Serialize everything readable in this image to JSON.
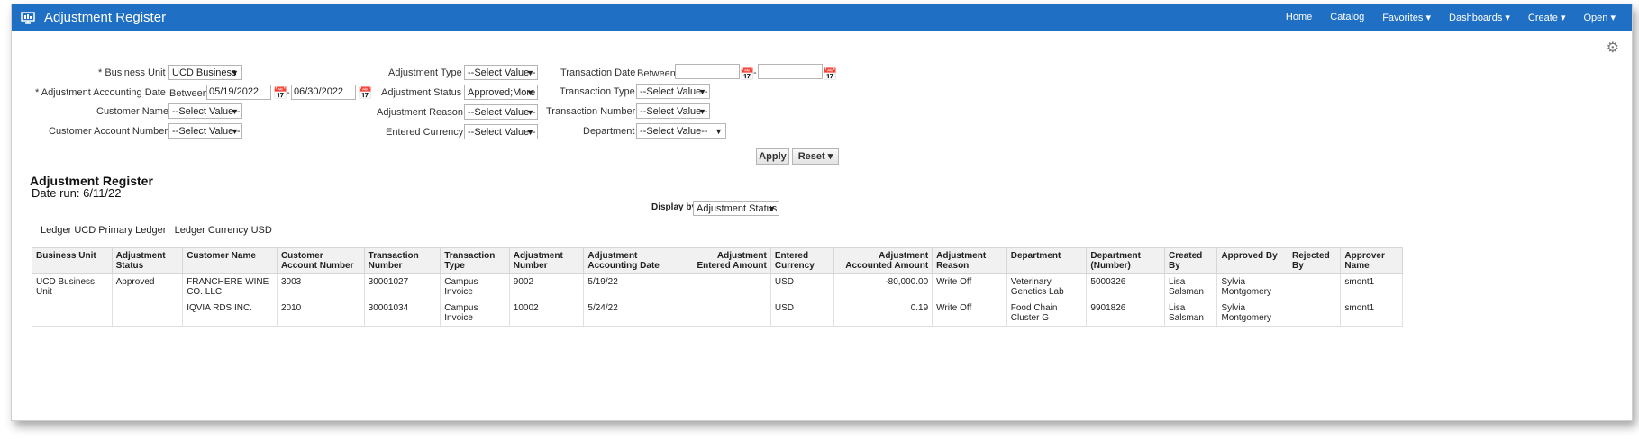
{
  "app": {
    "title": "Adjustment Register"
  },
  "nav": {
    "home": "Home",
    "catalog": "Catalog",
    "favorites": "Favorites ▾",
    "dashboards": "Dashboards ▾",
    "create": "Create ▾",
    "open": "Open ▾"
  },
  "prompts": {
    "business_unit": {
      "label": "* Business Unit",
      "value": "UCD Business"
    },
    "acct_date": {
      "label": "* Adjustment Accounting Date",
      "between": "Between",
      "from": "05/19/2022",
      "dash": "-",
      "to": "06/30/2022"
    },
    "customer_name": {
      "label": "Customer Name",
      "value": "--Select Value--"
    },
    "customer_account": {
      "label": "Customer Account Number",
      "value": "--Select Value--"
    },
    "adj_type": {
      "label": "Adjustment Type",
      "value": "--Select Value--"
    },
    "adj_status": {
      "label": "Adjustment Status",
      "value": "Approved;More"
    },
    "adj_reason": {
      "label": "Adjustment Reason",
      "value": "--Select Value--"
    },
    "entered_currency": {
      "label": "Entered Currency",
      "value": "--Select Value--"
    },
    "trx_date": {
      "label": "Transaction Date",
      "between": "Between",
      "from": "",
      "dash": "-",
      "to": ""
    },
    "trx_type": {
      "label": "Transaction Type",
      "value": "--Select Value--"
    },
    "trx_number": {
      "label": "Transaction Number",
      "value": "--Select Value--"
    },
    "department": {
      "label": "Department",
      "value": "--Select Value--"
    },
    "apply": "Apply",
    "reset": "Reset ▾"
  },
  "report": {
    "title": "Adjustment Register",
    "date_run": "Date run: 6/11/22",
    "display_by_label": "Display by",
    "display_by_value": "Adjustment Status",
    "ledger_label": "Ledger",
    "ledger_value": "UCD Primary Ledger",
    "ledger_currency_label": "Ledger Currency",
    "ledger_currency_value": "USD",
    "headers": [
      "Business Unit",
      "Adjustment Status",
      "Customer Name",
      "Customer Account Number",
      "Transaction Number",
      "Transaction Type",
      "Adjustment Number",
      "Adjustment Accounting Date",
      "Adjustment Entered Amount",
      "Entered Currency",
      "Adjustment Accounted Amount",
      "Adjustment Reason",
      "Department",
      "Department (Number)",
      "Created By",
      "Approved By",
      "Rejected By",
      "Approver Name"
    ],
    "group": {
      "business_unit": "UCD Business Unit",
      "status": "Approved"
    },
    "rows": [
      [
        "FRANCHERE WINE CO. LLC",
        "3003",
        "30001027",
        "Campus Invoice",
        "9002",
        "5/19/22",
        "",
        "USD",
        "-80,000.00",
        "Write Off",
        "Veterinary Genetics Lab",
        "5000326",
        "Lisa Salsman",
        "Sylvia Montgomery",
        "",
        "smont1"
      ],
      [
        "IQVIA RDS INC.",
        "2010",
        "30001034",
        "Campus Invoice",
        "10002",
        "5/24/22",
        "",
        "USD",
        "0.19",
        "Write Off",
        "Food Chain Cluster G",
        "9901826",
        "Lisa Salsman",
        "Sylvia Montgomery",
        "",
        "smont1"
      ]
    ]
  }
}
